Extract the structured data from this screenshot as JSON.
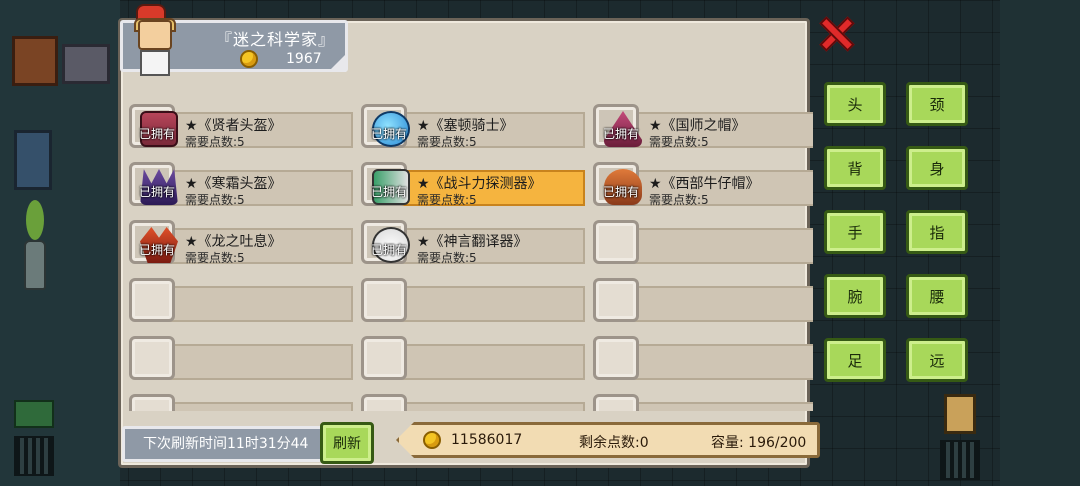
{
  "profile": {
    "title": "『迷之科学家』",
    "gold": "1967"
  },
  "items": [
    {
      "name": "★《贤者头盔》",
      "cost": "需要点数:5",
      "owned": "已拥有",
      "icon": "helmet-icon",
      "selected": false
    },
    {
      "name": "★《塞顿骑士》",
      "cost": "需要点数:5",
      "owned": "已拥有",
      "icon": "slime-knight-icon",
      "selected": false
    },
    {
      "name": "★《国师之帽》",
      "cost": "需要点数:5",
      "owned": "已拥有",
      "icon": "wizard-hat-icon",
      "selected": false
    },
    {
      "name": "★《寒霜头盔》",
      "cost": "需要点数:5",
      "owned": "已拥有",
      "icon": "frost-helmet-icon",
      "selected": false
    },
    {
      "name": "★《战斗力探测器》",
      "cost": "需要点数:5",
      "owned": "已拥有",
      "icon": "scouter-icon",
      "selected": true
    },
    {
      "name": "★《西部牛仔帽》",
      "cost": "需要点数:5",
      "owned": "已拥有",
      "icon": "cowboy-hat-icon",
      "selected": false
    },
    {
      "name": "★《龙之吐息》",
      "cost": "需要点数:5",
      "owned": "已拥有",
      "icon": "dragon-breath-icon",
      "selected": false
    },
    {
      "name": "★《神言翻译器》",
      "cost": "需要点数:5",
      "owned": "已拥有",
      "icon": "translator-icon",
      "selected": false
    }
  ],
  "slots": [
    "头",
    "颈",
    "背",
    "身",
    "手",
    "指",
    "腕",
    "腰",
    "足",
    "远"
  ],
  "footer": {
    "refresh_time": "下次刷新时间11时31分44",
    "refresh_button": "刷新",
    "gold": "11586017",
    "points": "剩余点数:0",
    "capacity": "容量: 196/200"
  },
  "colors": {
    "selected_item": "#f5b43f",
    "slot_button": "#a8d85a",
    "close": "#e02a2a"
  }
}
